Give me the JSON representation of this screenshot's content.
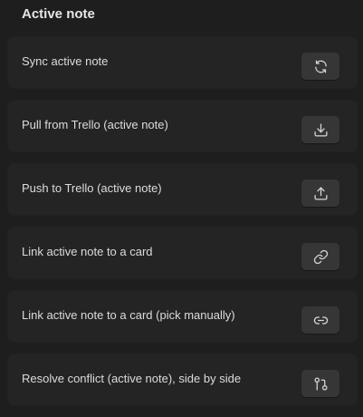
{
  "section": {
    "title": "Active note"
  },
  "items": [
    {
      "label": "Sync active note",
      "icon": "sync-icon"
    },
    {
      "label": "Pull from Trello (active note)",
      "icon": "download-icon"
    },
    {
      "label": "Push to Trello (active note)",
      "icon": "upload-icon"
    },
    {
      "label": "Link active note to a card",
      "icon": "link-icon"
    },
    {
      "label": "Link active note to a card (pick manually)",
      "icon": "link-horizontal-icon"
    },
    {
      "label": "Resolve conflict (active note), side by side",
      "icon": "git-compare-icon"
    }
  ],
  "colors": {
    "background": "#1e1e1e",
    "card": "#242424",
    "button": "#363636",
    "text": "#dcdcdc"
  }
}
